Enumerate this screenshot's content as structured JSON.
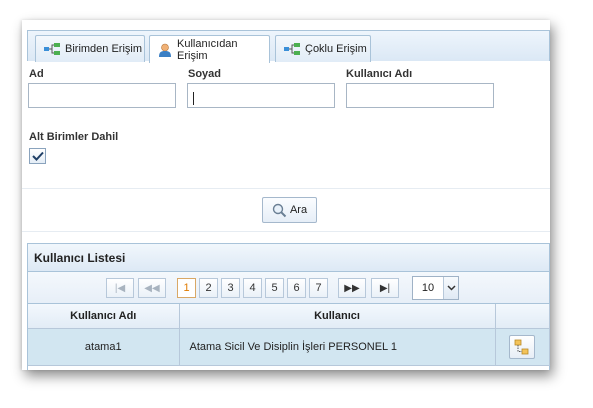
{
  "tabs": [
    {
      "label": "Birimden Erişim",
      "icon": "org-structure-icon",
      "active": false
    },
    {
      "label": "Kullanıcıdan Erişim",
      "icon": "user-icon",
      "active": true
    },
    {
      "label": "Çoklu Erişim",
      "icon": "org-structure-icon",
      "active": false
    }
  ],
  "form": {
    "ad_label": "Ad",
    "ad_value": "",
    "soyad_label": "Soyad",
    "soyad_value": "",
    "kullanici_adi_label": "Kullanıcı Adı",
    "kullanici_adi_value": "",
    "alt_birimler_label": "Alt Birimler Dahil",
    "alt_birimler_checked": true,
    "search_button_label": "Ara"
  },
  "list": {
    "title": "Kullanıcı Listesi",
    "pager": {
      "first": "|◀",
      "prev": "◀◀",
      "pages": [
        "1",
        "2",
        "3",
        "4",
        "5",
        "6",
        "7"
      ],
      "current_page": "1",
      "next": "▶▶",
      "last": "▶|",
      "page_size": "10"
    },
    "columns": [
      "Kullanıcı Adı",
      "Kullanıcı",
      ""
    ],
    "rows": [
      {
        "username": "atama1",
        "user": "Atama Sicil Ve Disiplin İşleri PERSONEL 1"
      }
    ]
  },
  "colors": {
    "border": "#a9c3d9",
    "selected_row": "#d2e6f1",
    "current_page": "#e07b00"
  }
}
